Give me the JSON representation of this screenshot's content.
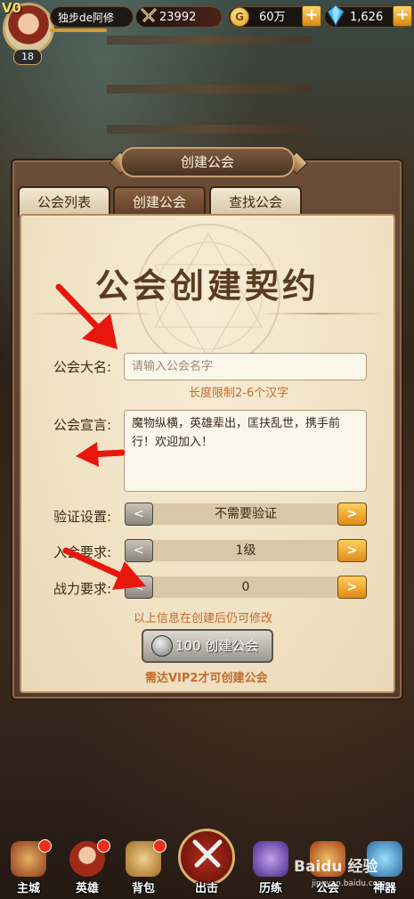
{
  "player": {
    "vip": "V0",
    "name": "独步de阿修",
    "level": "18",
    "power": "23992",
    "gold": "60万",
    "gems": "1,626"
  },
  "dialog": {
    "title": "创建公会"
  },
  "tabs": [
    {
      "label": "公会列表",
      "active": false
    },
    {
      "label": "创建公会",
      "active": true
    },
    {
      "label": "查找公会",
      "active": false
    }
  ],
  "form": {
    "heading": "公会创建契约",
    "name_label": "公会大名:",
    "name_placeholder": "请输入公会名字",
    "name_hint": "长度限制2-6个汉字",
    "declaration_label": "公会宣言:",
    "declaration_value": "魔物纵横，英雄辈出，匡扶乱世，携手前行！欢迎加入！",
    "verify_label": "验证设置:",
    "verify_value": "不需要验证",
    "join_label": "入会要求:",
    "join_value": "1级",
    "power_label": "战力要求:",
    "power_value": "0",
    "prev": "<",
    "next": ">",
    "edit_note": "以上信息在创建后仍可修改",
    "create_button": "100 创建公会",
    "vip_note": "需达VIP2才可创建公会"
  },
  "nav": [
    {
      "label": "主城",
      "badge": true
    },
    {
      "label": "英雄",
      "badge": true
    },
    {
      "label": "背包",
      "badge": true
    },
    {
      "label": "出击",
      "badge": false
    },
    {
      "label": "历练",
      "badge": false
    },
    {
      "label": "公会",
      "badge": false
    },
    {
      "label": "神器",
      "badge": false
    }
  ],
  "watermark": {
    "text": "Baidu 经验",
    "url": "jingyan.baidu.com"
  },
  "colors": {
    "accent": "#e08a18",
    "hint": "#c46a2a",
    "arrow": "#e8160c"
  }
}
